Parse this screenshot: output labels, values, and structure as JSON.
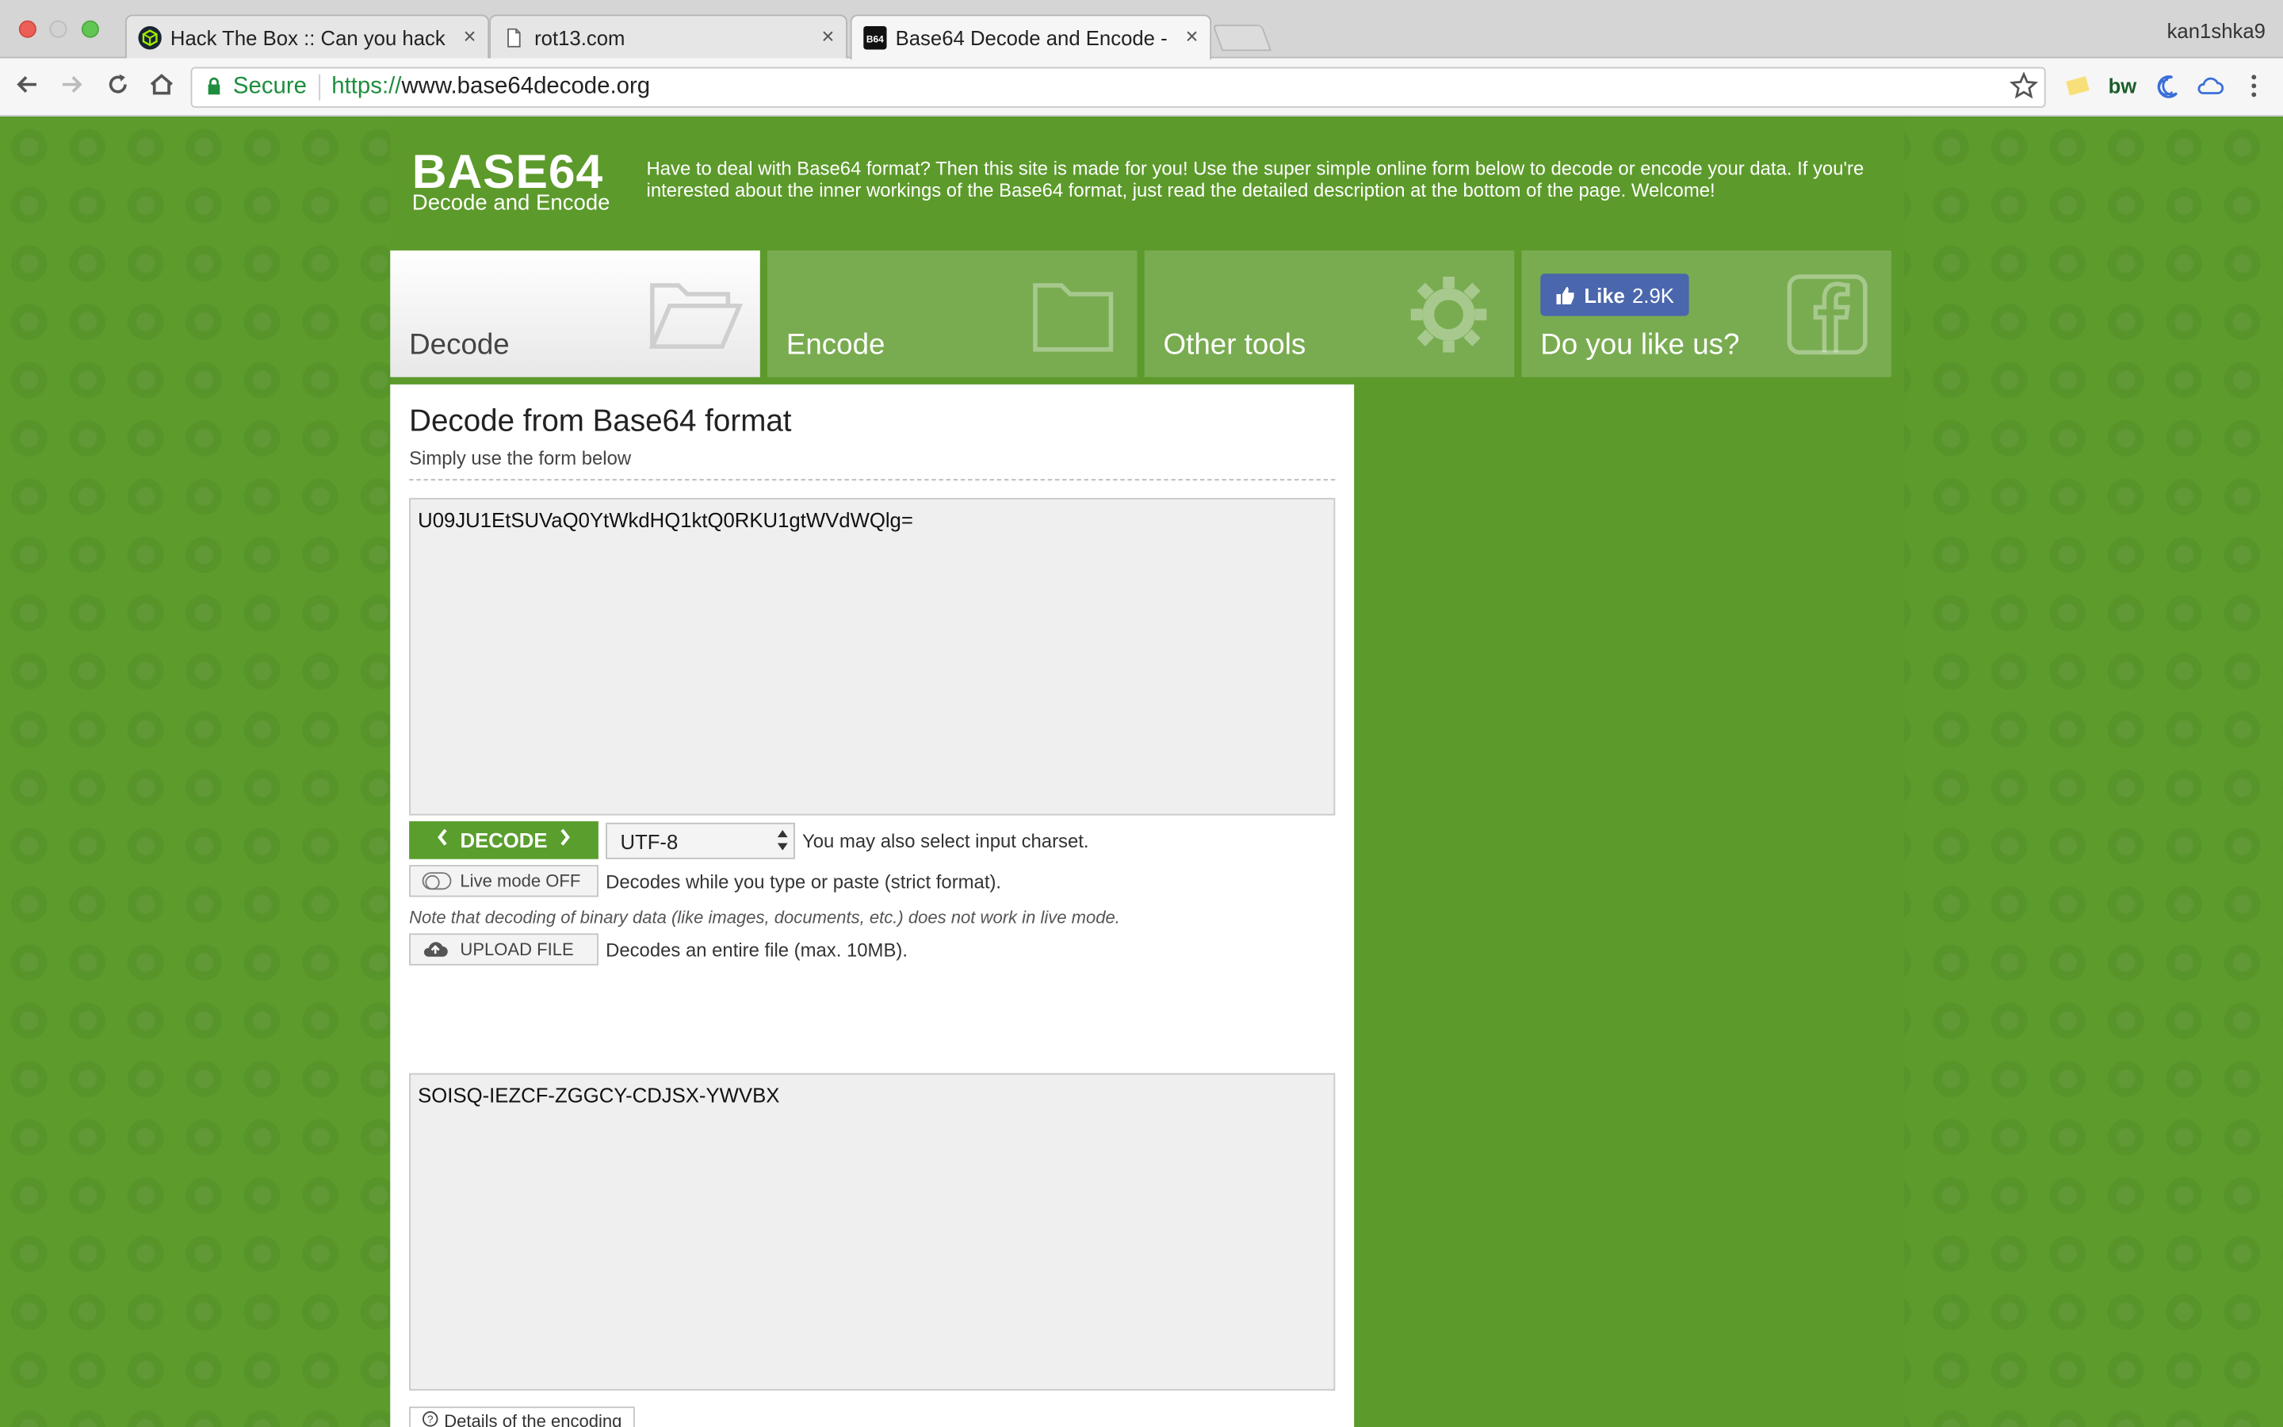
{
  "browser": {
    "tabs": [
      {
        "title": "Hack The Box :: Can you hack",
        "favicon": "htb-cube-icon"
      },
      {
        "title": "rot13.com",
        "favicon": "document-icon"
      },
      {
        "title": "Base64 Decode and Encode -",
        "favicon": "b64-icon"
      }
    ],
    "profile_name": "kan1shka9",
    "close_glyph": "×",
    "address": {
      "secure_label": "Secure",
      "scheme": "https://",
      "host": "www.base64decode.org"
    }
  },
  "site": {
    "logo_title": "BASE64",
    "logo_subtitle": "Decode and Encode",
    "intro": "Have to deal with Base64 format? Then this site is made for you! Use the super simple online form below to decode or encode your data. If you're interested about the inner workings of the Base64 format, just read the detailed description at the bottom of the page. Welcome!",
    "nav": {
      "decode": "Decode",
      "encode": "Encode",
      "other_tools": "Other tools",
      "like_us": "Do you like us?",
      "fb_like": "Like",
      "fb_count": "2.9K"
    }
  },
  "panel": {
    "title": "Decode from Base64 format",
    "subtitle": "Simply use the form below",
    "input_value": "U09JU1EtSUVaQ0YtWkdHQ1ktQ0RKU1gtWVdWQlg=",
    "decode_label": "DECODE",
    "charset_value": "UTF-8",
    "charset_hint": "You may also select input charset.",
    "live_mode_label": "Live mode OFF",
    "live_mode_hint": "Decodes while you type or paste (strict format).",
    "binary_note": "Note that decoding of binary data (like images, documents, etc.) does not work in live mode.",
    "upload_label": "UPLOAD FILE",
    "upload_hint": "Decodes an entire file (max. 10MB).",
    "output_value": "SOISQ-IEZCF-ZGGCY-CDJSX-YWVBX",
    "details_label": "Details of the encoding"
  },
  "colors": {
    "page_green": "#5c9c2c",
    "button_green": "#5a9e2e",
    "facebook_blue": "#4a66ad",
    "secure_green": "#1e8e3e"
  }
}
